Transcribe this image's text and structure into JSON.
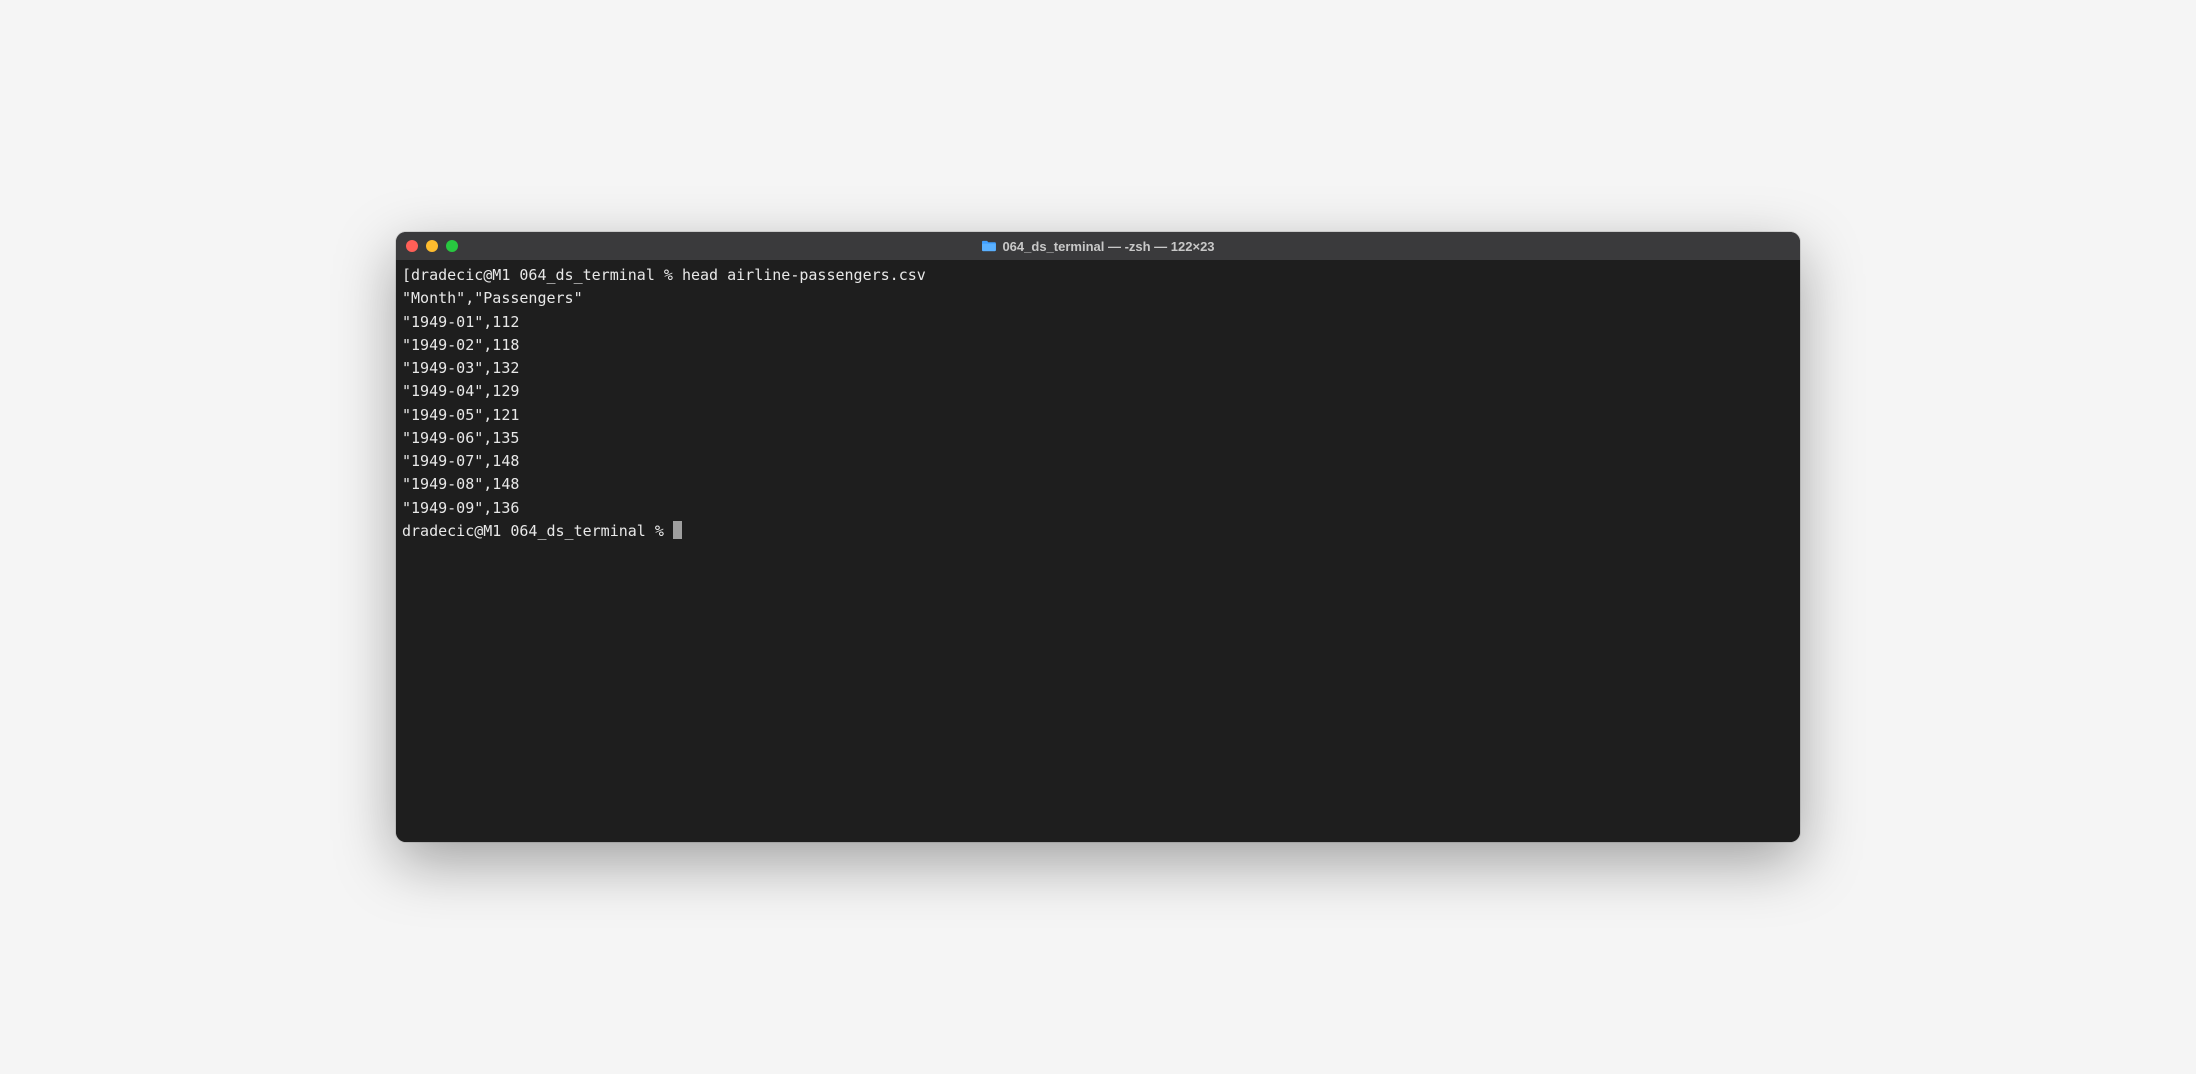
{
  "titlebar": {
    "title": "064_ds_terminal — -zsh — 122×23"
  },
  "terminal": {
    "prompt1_prefix": "[",
    "prompt1": "dradecic@M1 064_ds_terminal % ",
    "command1": "head airline-passengers.csv",
    "output": [
      "\"Month\",\"Passengers\"",
      "\"1949-01\",112",
      "\"1949-02\",118",
      "\"1949-03\",132",
      "\"1949-04\",129",
      "\"1949-05\",121",
      "\"1949-06\",135",
      "\"1949-07\",148",
      "\"1949-08\",148",
      "\"1949-09\",136"
    ],
    "prompt2": "dradecic@M1 064_ds_terminal % "
  }
}
